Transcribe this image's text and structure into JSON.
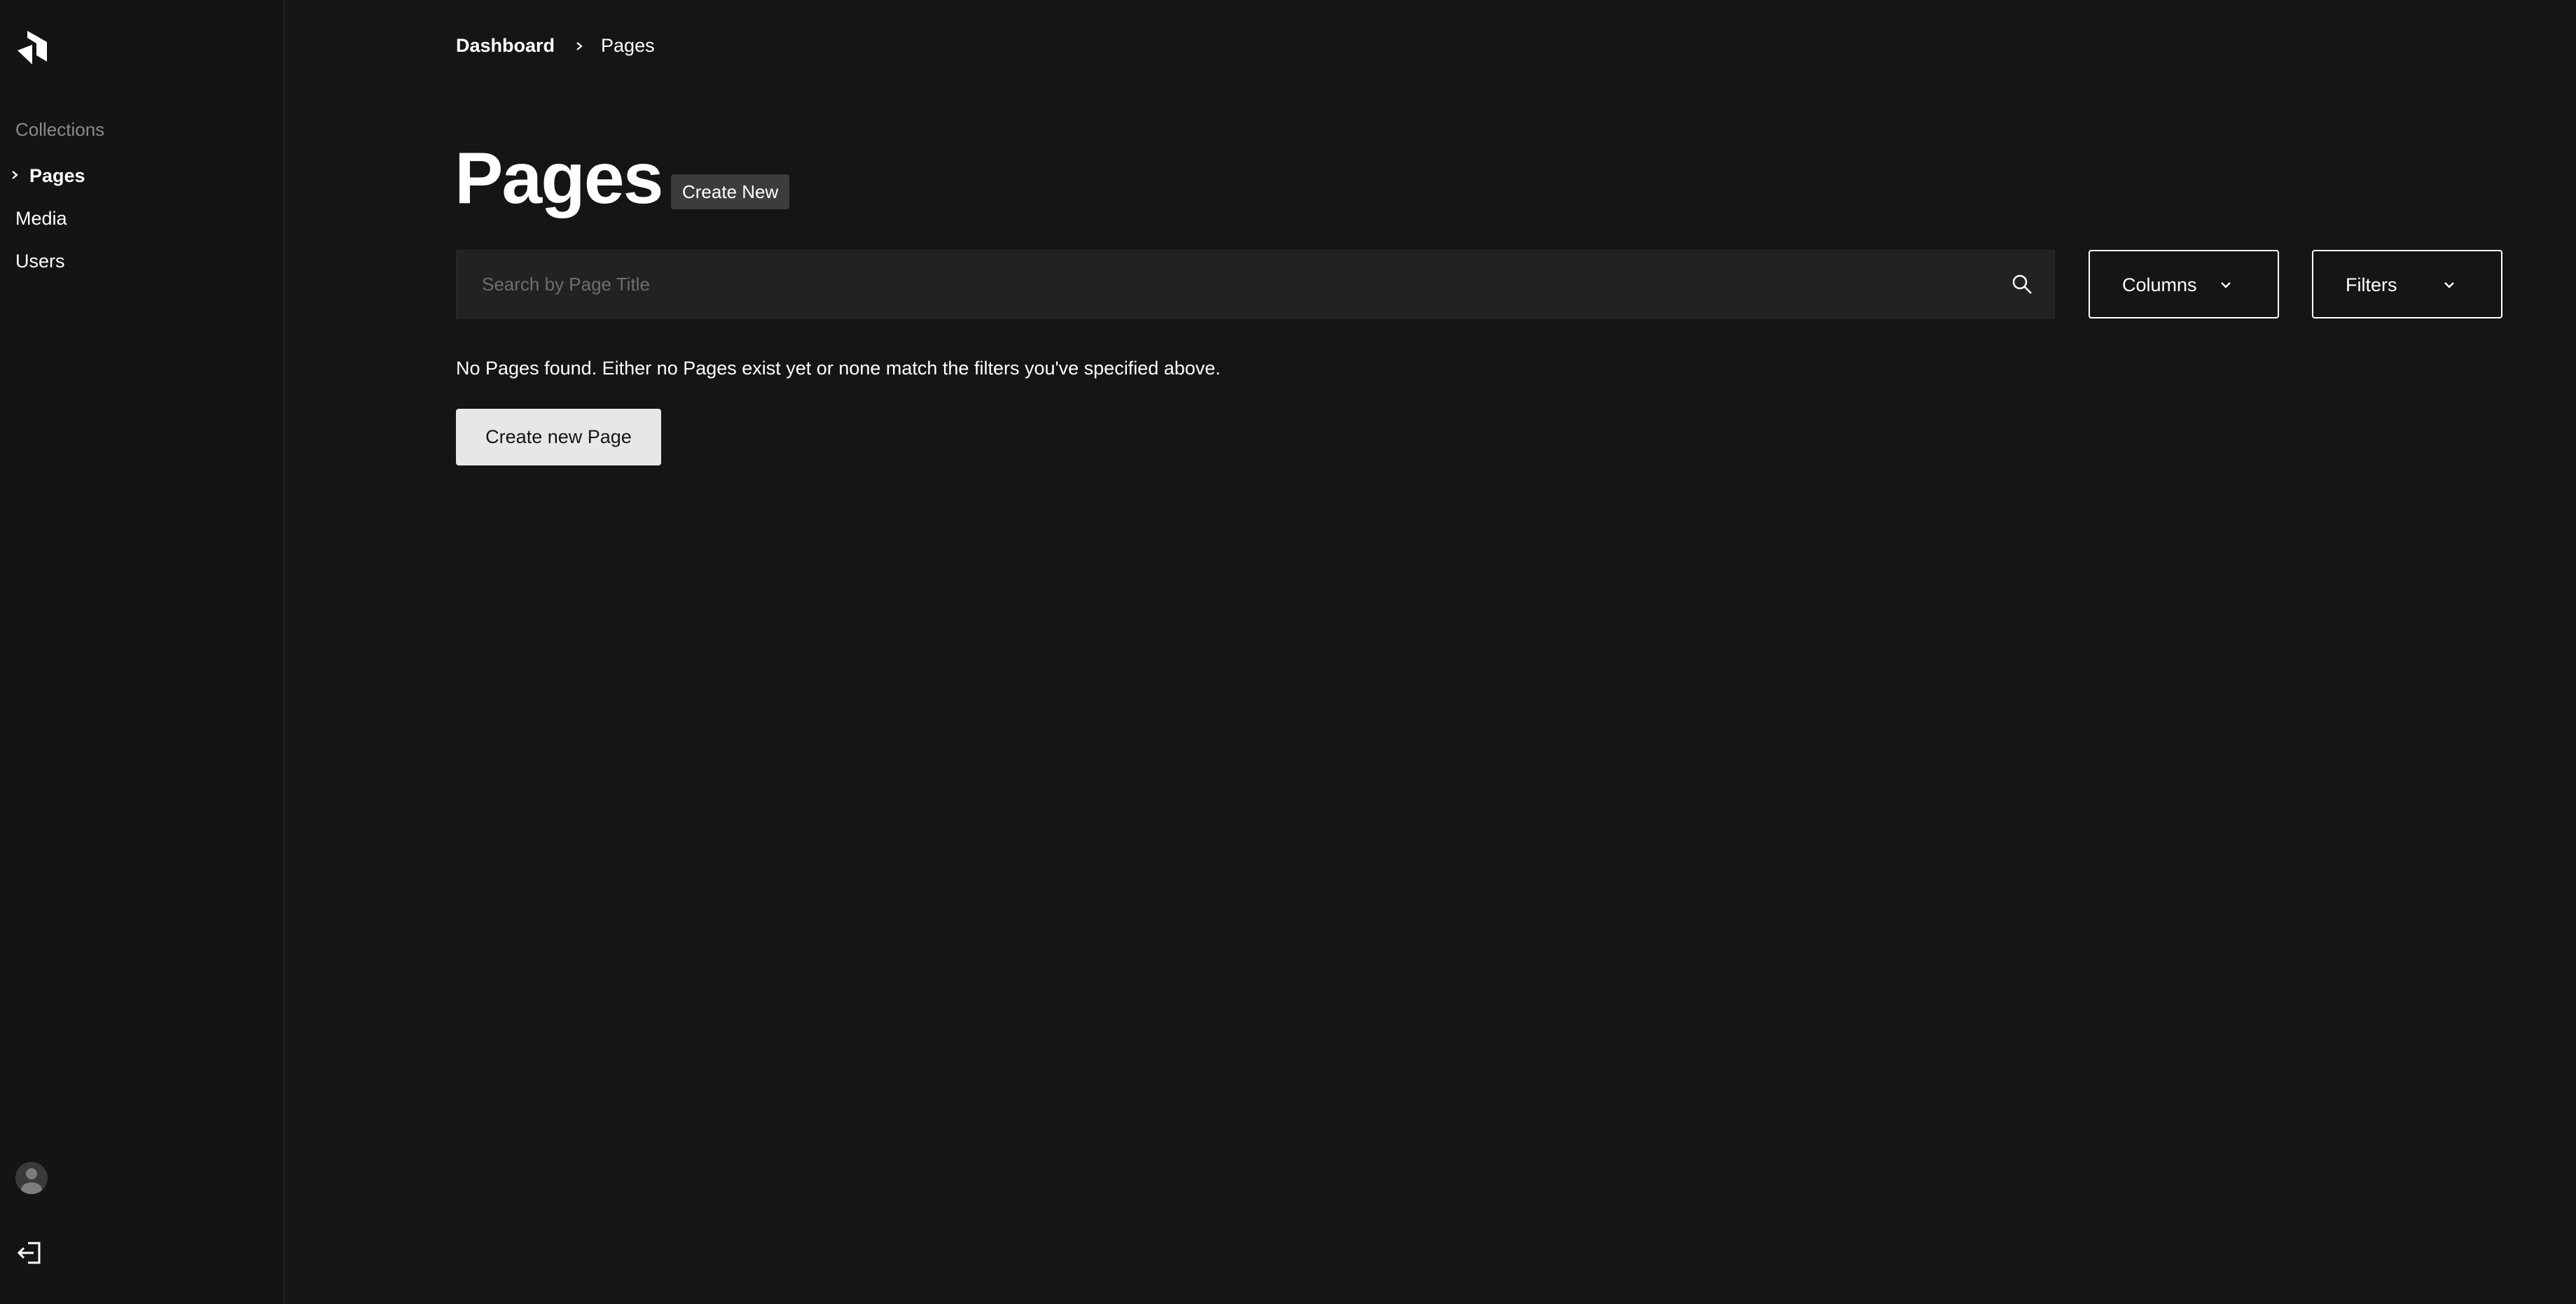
{
  "sidebar": {
    "heading": "Collections",
    "items": [
      {
        "label": "Pages",
        "active": true
      },
      {
        "label": "Media",
        "active": false
      },
      {
        "label": "Users",
        "active": false
      }
    ]
  },
  "breadcrumb": {
    "root": "Dashboard",
    "current": "Pages"
  },
  "header": {
    "title": "Pages",
    "create_label": "Create New"
  },
  "search": {
    "placeholder": "Search by Page Title",
    "value": ""
  },
  "controls": {
    "columns_label": "Columns",
    "filters_label": "Filters"
  },
  "empty_state": {
    "message": "No Pages found. Either no Pages exist yet or none match the filters you've specified above.",
    "button_label": "Create new Page"
  },
  "colors": {
    "background": "#151416",
    "sidebar": "#141414",
    "button_light": "#e7e6e9",
    "pill": "#3c3c3f"
  }
}
